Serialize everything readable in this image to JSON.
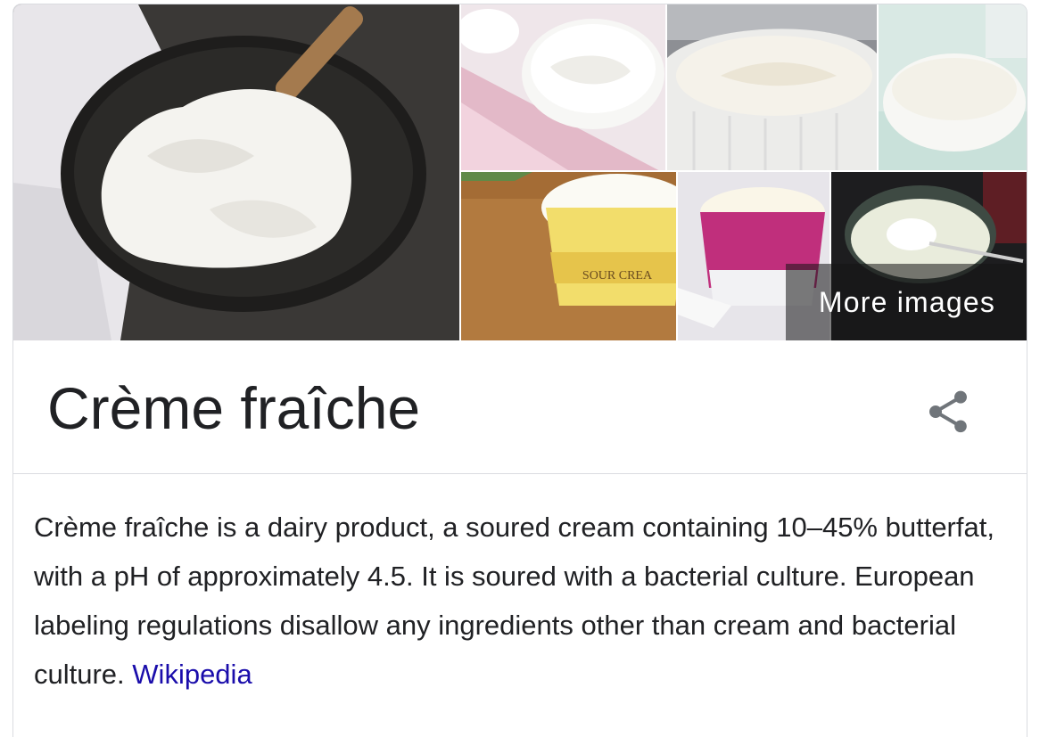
{
  "gallery": {
    "more_images_label": "More images",
    "images": [
      {
        "subject": "creme fraiche in dark bowl with wooden spoon"
      },
      {
        "subject": "creme fraiche in glass bowl on pink napkin"
      },
      {
        "subject": "creme fraiche in white ramekin"
      },
      {
        "subject": "creme fraiche in white bowl"
      },
      {
        "subject": "sour cream tub"
      },
      {
        "subject": "creme fraiche container with pink label"
      },
      {
        "subject": "creme fraiche jar with spoon"
      }
    ]
  },
  "entity": {
    "title": "Crème fraîche",
    "share_icon": "share-icon"
  },
  "description": {
    "text": "Crème fraîche is a dairy product, a soured cream containing 10–45% butterfat, with a pH of approximately 4.5. It is soured with a bacterial culture. European labeling regulations disallow any ingredients other than cream and bacterial culture.",
    "source_link": "Wikipedia"
  },
  "colors": {
    "link": "#1a0dab",
    "border": "#dadce0",
    "text": "#202124",
    "icon": "#70757a"
  }
}
